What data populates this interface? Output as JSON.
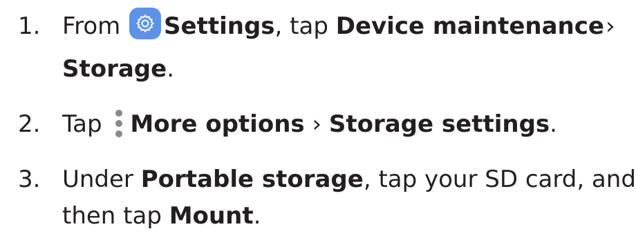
{
  "steps": [
    {
      "number": "1.",
      "line1": {
        "t1": "From ",
        "settings": "Settings",
        "t2": ", tap ",
        "device_maintenance": "Device maintenance",
        "sep": " ›"
      },
      "line2": {
        "storage": "Storage",
        "t3": "."
      },
      "icon": "settings-gear-icon"
    },
    {
      "number": "2.",
      "line1": {
        "t1": "Tap ",
        "more_options": "More options",
        "sep": " › ",
        "storage_settings": "Storage settings",
        "t2": "."
      },
      "icon": "more-options-icon"
    },
    {
      "number": "3.",
      "line1": {
        "t1": "Under ",
        "portable_storage": "Portable storage",
        "t2": ", tap your SD card, and"
      },
      "line2": {
        "t1": "then tap ",
        "mount": "Mount",
        "t2": "."
      }
    }
  ],
  "colors": {
    "text": "#231f20",
    "settings_icon_bg": "#5d92e6",
    "more_icon_dots": "#8a8a8a"
  }
}
